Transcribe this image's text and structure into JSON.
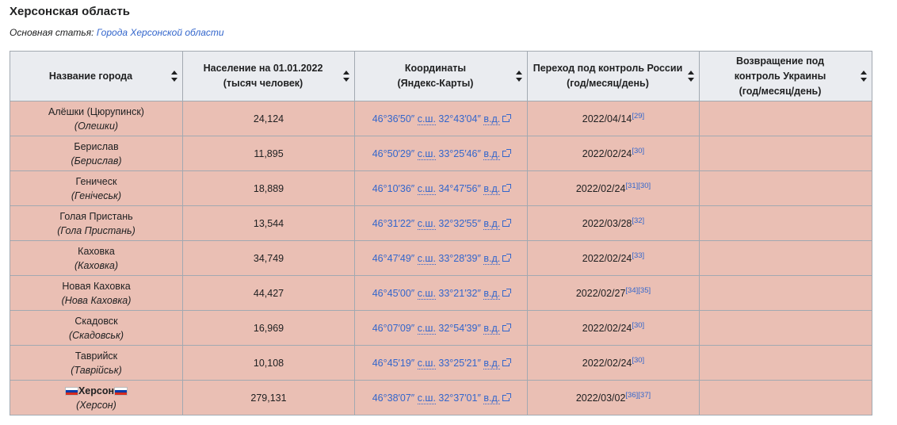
{
  "section_title": "Херсонская область",
  "hatnote": {
    "prefix": "Основная статья: ",
    "link": "Города Херсонской области"
  },
  "headers": [
    {
      "line1": "Название города",
      "line2": "",
      "line3": ""
    },
    {
      "line1": "Население на 01.01.2022",
      "line2": "(тысяч человек)",
      "line3": ""
    },
    {
      "line1": "Координаты",
      "line2": "(Яндекс-Карты)",
      "line3": ""
    },
    {
      "line1": "Переход под контроль России",
      "line2": "(год/месяц/день)",
      "line3": ""
    },
    {
      "line1": "Возвращение под",
      "line2": "контроль Украины",
      "line3": "(год/месяц/день)"
    }
  ],
  "coord_labels": {
    "n": "с.ш.",
    "e": "в.д."
  },
  "colors": {
    "row_bg": "#eabfb4",
    "header_bg": "#eaecf0",
    "link": "#3366cc",
    "border": "#a2a9b1"
  },
  "rows": [
    {
      "name": "Алёшки (Цюрупинск)",
      "alt": "(Олешки)",
      "pop": "24,124",
      "lat": "46°36′50″",
      "lon": "32°43′04″",
      "date": "2022/04/14",
      "refs": "[29]",
      "returned": ""
    },
    {
      "name": "Берислав",
      "alt": "(Берислав)",
      "pop": "11,895",
      "lat": "46°50′29″",
      "lon": "33°25′46″",
      "date": "2022/02/24",
      "refs": "[30]",
      "returned": ""
    },
    {
      "name": "Геническ",
      "alt": "(Генічеськ)",
      "pop": "18,889",
      "lat": "46°10′36″",
      "lon": "34°47′56″",
      "date": "2022/02/24",
      "refs": "[31][30]",
      "returned": ""
    },
    {
      "name": "Голая Пристань",
      "alt": "(Гола Пристань)",
      "pop": "13,544",
      "lat": "46°31′22″",
      "lon": "32°32′55″",
      "date": "2022/03/28",
      "refs": "[32]",
      "returned": ""
    },
    {
      "name": "Каховка",
      "alt": "(Каховка)",
      "pop": "34,749",
      "lat": "46°47′49″",
      "lon": "33°28′39″",
      "date": "2022/02/24",
      "refs": "[33]",
      "returned": ""
    },
    {
      "name": "Новая Каховка",
      "alt": "(Нова Каховка)",
      "pop": "44,427",
      "lat": "46°45′00″",
      "lon": "33°21′32″",
      "date": "2022/02/27",
      "refs": "[34][35]",
      "returned": ""
    },
    {
      "name": "Скадовск",
      "alt": "(Скадовськ)",
      "pop": "16,969",
      "lat": "46°07′09″",
      "lon": "32°54′39″",
      "date": "2022/02/24",
      "refs": "[30]",
      "returned": ""
    },
    {
      "name": "Таврийск",
      "alt": "(Таврійськ)",
      "pop": "10,108",
      "lat": "46°45′19″",
      "lon": "33°25′21″",
      "date": "2022/02/24",
      "refs": "[30]",
      "returned": ""
    },
    {
      "name": "Херсон",
      "alt": "(Херсон)",
      "pop": "279,131",
      "lat": "46°38′07″",
      "lon": "32°37′01″",
      "date": "2022/03/02",
      "refs": "[36][37]",
      "returned": "",
      "flags": true
    }
  ]
}
